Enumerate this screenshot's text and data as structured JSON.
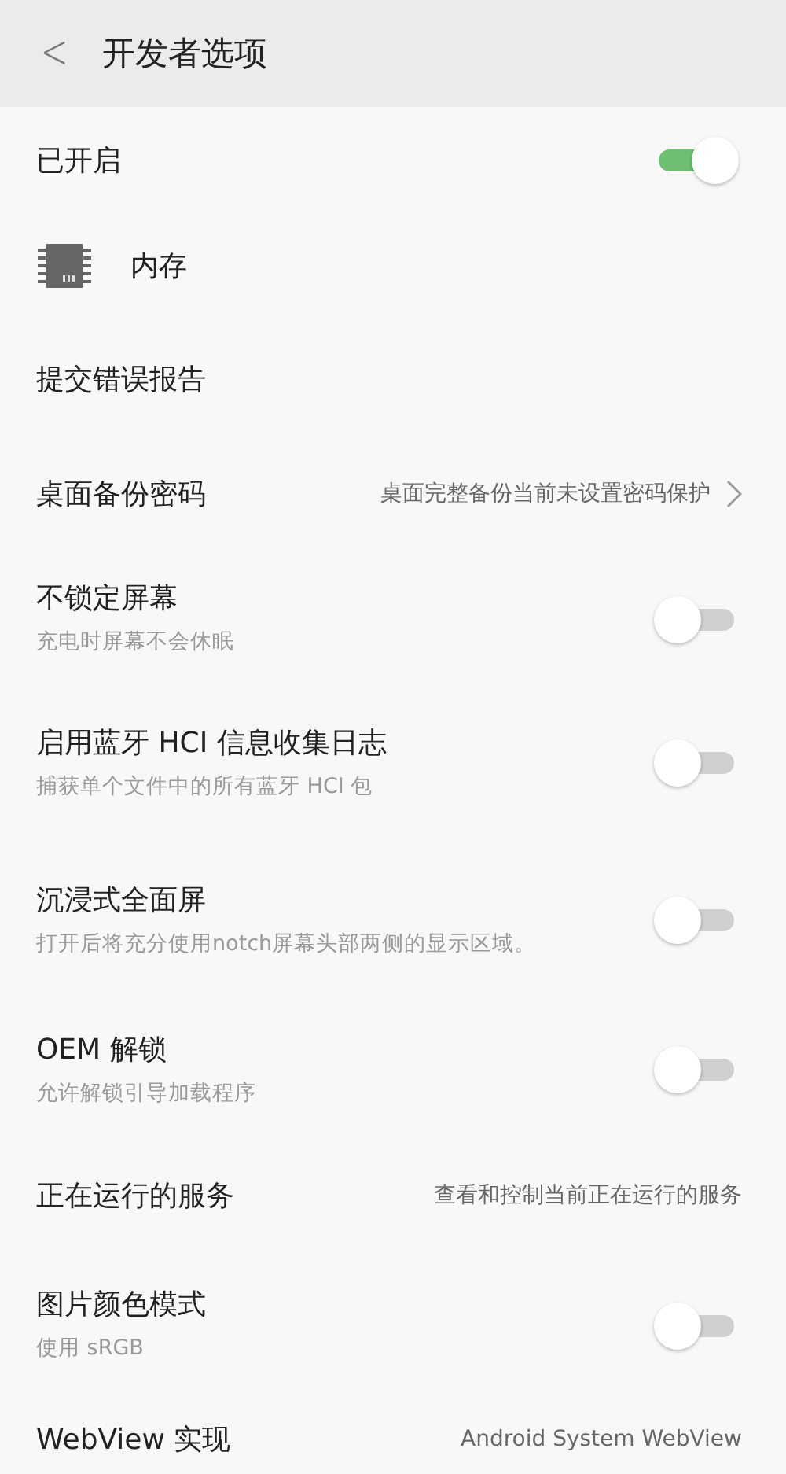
{
  "header": {
    "back": "<",
    "title": "开发者选项"
  },
  "rows": [
    {
      "kind": "toggle",
      "title": "已开启",
      "on": true
    },
    {
      "kind": "icon",
      "title": "内存"
    },
    {
      "kind": "plain",
      "title": "提交错误报告"
    },
    {
      "kind": "link",
      "title": "桌面备份密码",
      "value": "桌面完整备份当前未设置密码保护"
    },
    {
      "kind": "toggle",
      "title": "不锁定屏幕",
      "subtitle": "充电时屏幕不会休眠",
      "on": false
    },
    {
      "kind": "toggle",
      "title": "启用蓝牙 HCI 信息收集日志",
      "subtitle": "捕获单个文件中的所有蓝牙 HCI 包",
      "on": false
    },
    {
      "kind": "toggle",
      "title": "沉浸式全面屏",
      "subtitle": "打开后将充分使用notch屏幕头部两侧的显示区域。",
      "on": false
    },
    {
      "kind": "toggle",
      "title": "OEM 解锁",
      "subtitle": "允许解锁引导加载程序",
      "on": false
    },
    {
      "kind": "value",
      "title": "正在运行的服务",
      "value": "查看和控制当前正在运行的服务"
    },
    {
      "kind": "toggle",
      "title": "图片颜色模式",
      "subtitle": "使用 sRGB",
      "on": false
    },
    {
      "kind": "value",
      "title": "WebView 实现",
      "value": "Android System WebView"
    }
  ]
}
